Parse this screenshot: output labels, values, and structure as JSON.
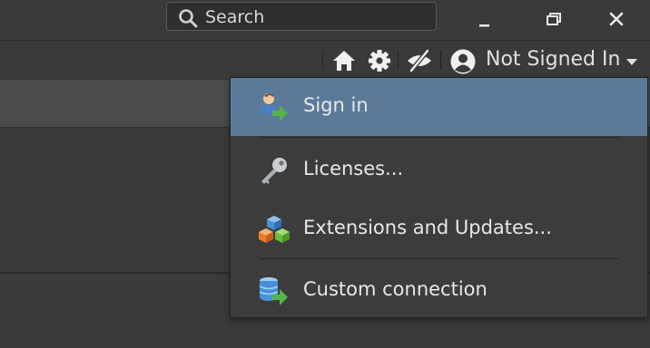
{
  "search": {
    "label": "Search",
    "icon": "search-icon"
  },
  "window_controls": [
    "minimize-icon",
    "restore-icon",
    "close-icon"
  ],
  "toolbar": {
    "icons": [
      "home-icon",
      "gear-icon",
      "hide-icon",
      "account-circle-icon"
    ],
    "account_label": "Not Signed In"
  },
  "menu": {
    "items": [
      {
        "label": "Sign in",
        "icon": "sign-in-icon",
        "active": true
      },
      {
        "label": "Licenses...",
        "icon": "key-icon",
        "active": false
      },
      {
        "label": "Extensions and Updates...",
        "icon": "extensions-icon",
        "active": false
      },
      {
        "label": "Custom connection",
        "icon": "database-connection-icon",
        "active": false
      }
    ]
  },
  "colors": {
    "background": "#3a3a3a",
    "menu_background": "#3c3c3c",
    "menu_highlight": "#5b7a99",
    "text": "#e6e6e6",
    "icon_green": "#56b54a"
  }
}
